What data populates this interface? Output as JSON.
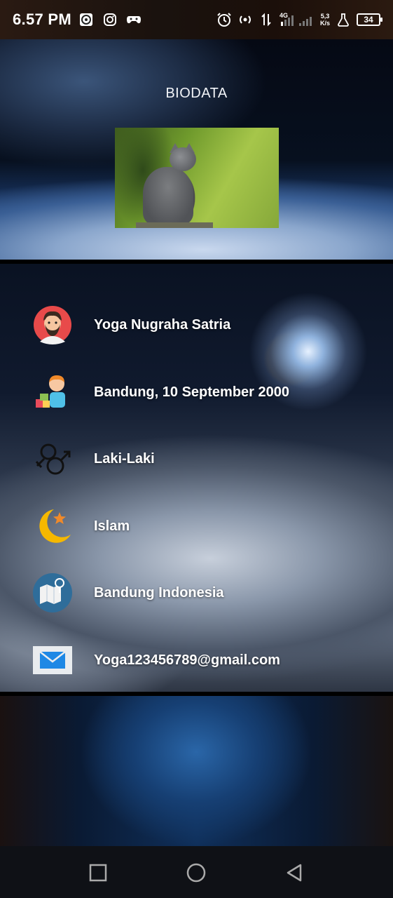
{
  "status_bar": {
    "time": "6.57 PM",
    "left_icons": [
      "target-app-icon",
      "instagram-icon",
      "gamepad-icon"
    ],
    "network": "4G",
    "speed_value": "5,3",
    "speed_unit": "K/s",
    "battery": "34"
  },
  "header": {
    "title": "BIODATA"
  },
  "profile": {
    "items": [
      {
        "icon": "person-avatar-icon",
        "text": "Yoga Nugraha Satria"
      },
      {
        "icon": "child-toys-icon",
        "text": "Bandung, 10 September 2000"
      },
      {
        "icon": "gender-symbol-icon",
        "text": "Laki-Laki"
      },
      {
        "icon": "crescent-star-icon",
        "text": "Islam"
      },
      {
        "icon": "map-location-icon",
        "text": "Bandung Indonesia"
      },
      {
        "icon": "email-icon",
        "text": "Yoga123456789@gmail.com"
      }
    ]
  },
  "nav": {
    "buttons": [
      "recents-button",
      "home-button",
      "back-button"
    ]
  },
  "colors": {
    "text": "#ffffff",
    "status_bar": "#1b120d",
    "nav_bar": "#0f1116"
  }
}
